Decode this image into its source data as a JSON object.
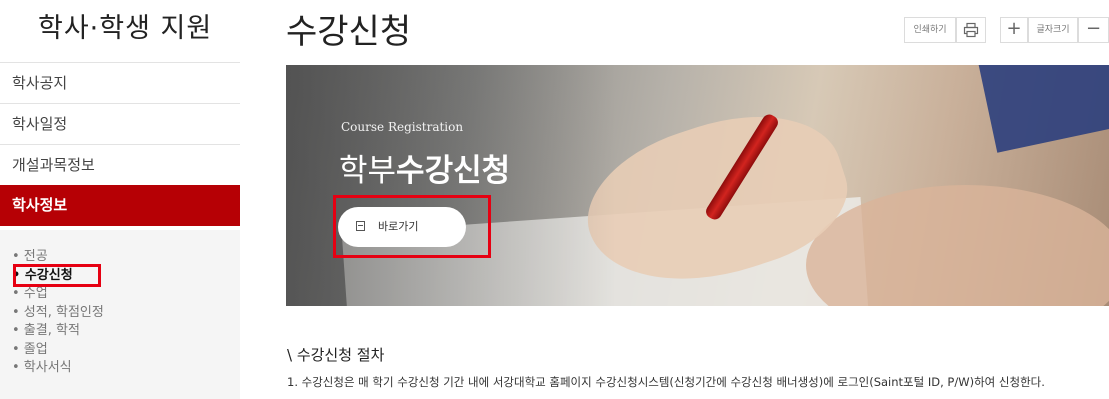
{
  "sidebar": {
    "title": "학사·학생 지원",
    "menu": [
      {
        "label": "학사공지"
      },
      {
        "label": "학사일정"
      },
      {
        "label": "개설과목정보"
      },
      {
        "label": "학사정보"
      }
    ],
    "active_menu": "학사정보",
    "submenu": [
      {
        "label": "• 전공"
      },
      {
        "label": "• 수강신청"
      },
      {
        "label": "• 수업"
      },
      {
        "label": "• 성적, 학점인정"
      },
      {
        "label": "• 출결, 학적"
      },
      {
        "label": "• 졸업"
      },
      {
        "label": "• 학사서식"
      }
    ],
    "selected_submenu": "• 수강신청"
  },
  "header": {
    "title": "수강신청",
    "tools": {
      "print_label": "인쇄하기",
      "font_size_label": "글자크기",
      "print_icon": "printer-icon",
      "plus_icon": "plus-icon",
      "minus_icon": "minus-icon"
    }
  },
  "banner": {
    "subtitle": "Course Registration",
    "title_light": "학부",
    "title_bold": "수강신청",
    "button_label": "바로가기",
    "button_icon": "document-icon"
  },
  "content": {
    "section_title": "\\ 수강신청 절차",
    "paragraph": "1. 수강신청은 매 학기 수강신청 기간 내에 서강대학교 홈페이지 수강신청시스템(신청기간에 수강신청 배너생성)에 로그인(Saint포털 ID, P/W)하여 신청한다."
  },
  "colors": {
    "accent": "#b60005",
    "highlight": "#e60012"
  }
}
